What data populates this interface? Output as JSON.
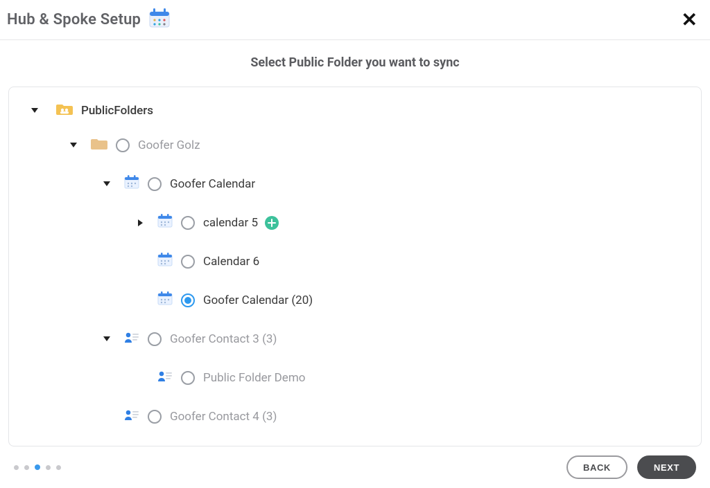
{
  "header": {
    "title": "Hub & Spoke Setup",
    "icon": "calendar-icon"
  },
  "subtitle": "Select Public Folder you want to sync",
  "tree": {
    "root": {
      "label": "PublicFolders",
      "expanded": true
    },
    "nodes": {
      "goofer_golz": {
        "label": "Goofer Golz",
        "expanded": true
      },
      "goofer_calendar": {
        "label": "Goofer Calendar",
        "expanded": true
      },
      "calendar_5": {
        "label": "calendar 5",
        "has_children": true,
        "expanded": false,
        "badge": "plus"
      },
      "calendar_6": {
        "label": "Calendar 6"
      },
      "goofer_calendar_20": {
        "label": "Goofer Calendar (20)",
        "selected": true
      },
      "goofer_contact_3": {
        "label": "Goofer Contact 3 (3)",
        "expanded": true
      },
      "public_folder_demo": {
        "label": "Public Folder Demo"
      },
      "goofer_contact_4": {
        "label": "Goofer Contact 4 (3)"
      }
    }
  },
  "footer": {
    "steps_total": 5,
    "active_step_index": 2,
    "back_label": "BACK",
    "next_label": "NEXT"
  },
  "icons": {
    "calendar": "calendar",
    "folder_yellow": "folder-yellow",
    "folder_tan": "folder-tan",
    "contact": "contact"
  }
}
